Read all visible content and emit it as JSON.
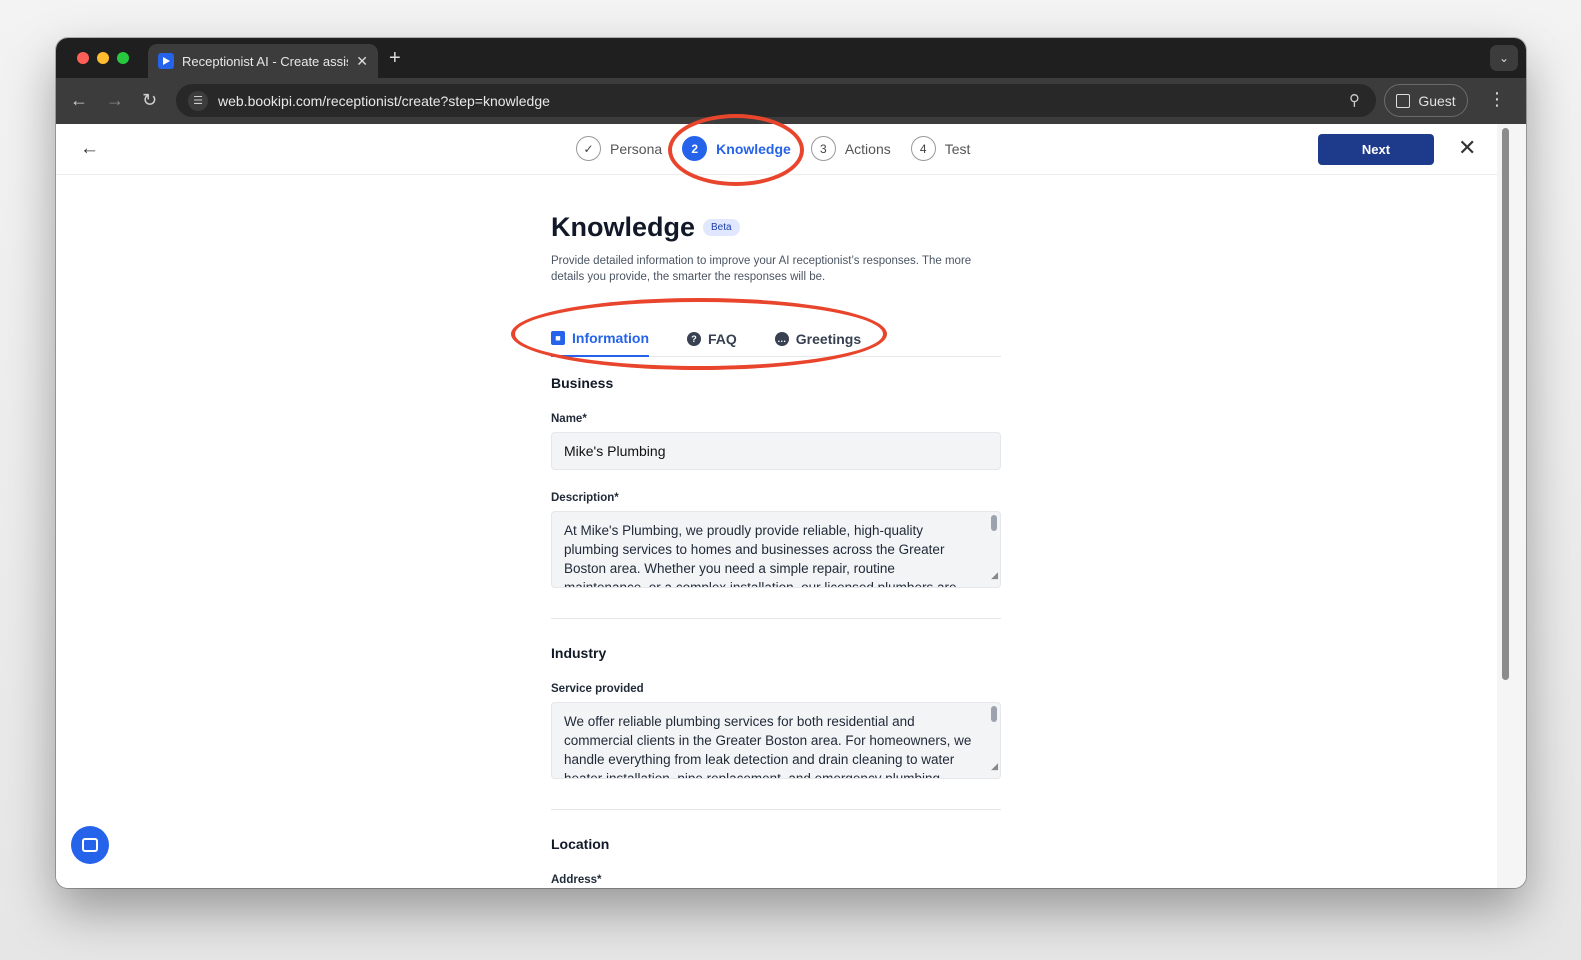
{
  "browser": {
    "tab_title": "Receptionist AI - Create assis",
    "url": "web.bookipi.com/receptionist/create?step=knowledge",
    "profile_label": "Guest"
  },
  "stepper": {
    "steps": [
      {
        "number": "✓",
        "label": "Persona",
        "state": "done"
      },
      {
        "number": "2",
        "label": "Knowledge",
        "state": "active"
      },
      {
        "number": "3",
        "label": "Actions",
        "state": "pending"
      },
      {
        "number": "4",
        "label": "Test",
        "state": "pending"
      }
    ]
  },
  "header": {
    "next_label": "Next"
  },
  "page": {
    "title": "Knowledge",
    "badge": "Beta",
    "description": "Provide detailed information to improve your AI receptionist’s responses. The more details you provide, the smarter the responses will be."
  },
  "subtabs": [
    {
      "label": "Information",
      "icon": "briefcase-icon",
      "active": true
    },
    {
      "label": "FAQ",
      "icon": "question-circle-icon",
      "active": false
    },
    {
      "label": "Greetings",
      "icon": "chat-bubble-icon",
      "active": false
    }
  ],
  "form": {
    "business": {
      "section_title": "Business",
      "name_label": "Name*",
      "name_value": "Mike's Plumbing",
      "description_label": "Description*",
      "description_value": "At Mike's Plumbing, we proudly provide reliable, high-quality plumbing services to homes and businesses across the Greater Boston area. Whether you need a simple repair, routine maintenance, or a complex installation, our licensed plumbers are equipped to"
    },
    "industry": {
      "section_title": "Industry",
      "service_label": "Service provided",
      "service_value": "We offer reliable plumbing services for both residential and commercial clients in the Greater Boston area. For homeowners, we handle everything from leak detection and drain cleaning to water heater installation, pipe replacement, and emergency plumbing"
    },
    "location": {
      "section_title": "Location",
      "address_label": "Address*"
    }
  },
  "colors": {
    "accent": "#2563eb",
    "next_button": "#1e3a8a",
    "annotation": "#e8452c"
  }
}
